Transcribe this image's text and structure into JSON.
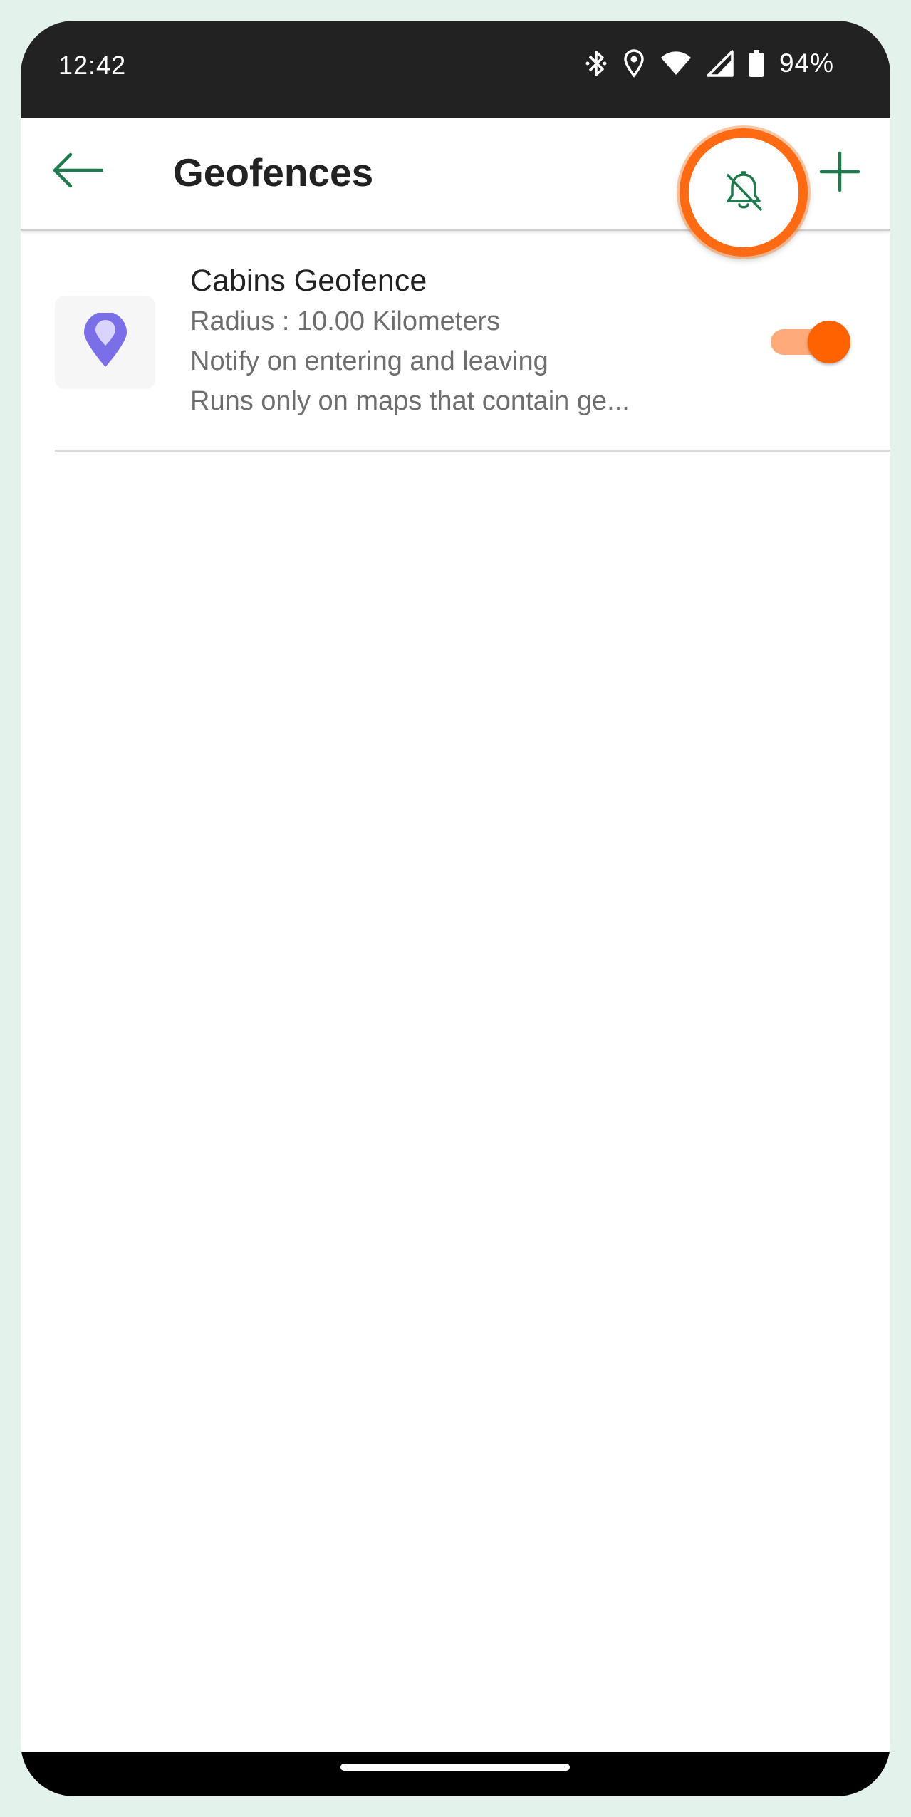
{
  "status_bar": {
    "time": "12:42",
    "battery": "94%",
    "icons": [
      "bluetooth-icon",
      "location-icon",
      "wifi-icon",
      "signal-icon",
      "battery-icon"
    ]
  },
  "app_bar": {
    "title": "Geofences",
    "back_icon": "back-arrow-icon",
    "bell_icon": "bell-off-icon",
    "add_icon": "plus-icon"
  },
  "geofences": [
    {
      "name": "Cabins Geofence",
      "radius": "Radius : 10.00 Kilometers",
      "notify": "Notify on entering and leaving",
      "runs": "Runs only on maps that contain ge...",
      "icon": "map-pin-icon",
      "enabled": true
    }
  ],
  "colors": {
    "accent_green": "#1f7a4d",
    "highlight_orange": "#ff6a12",
    "toggle_on": "#ff6200",
    "pin_purple": "#7b6fe8"
  }
}
